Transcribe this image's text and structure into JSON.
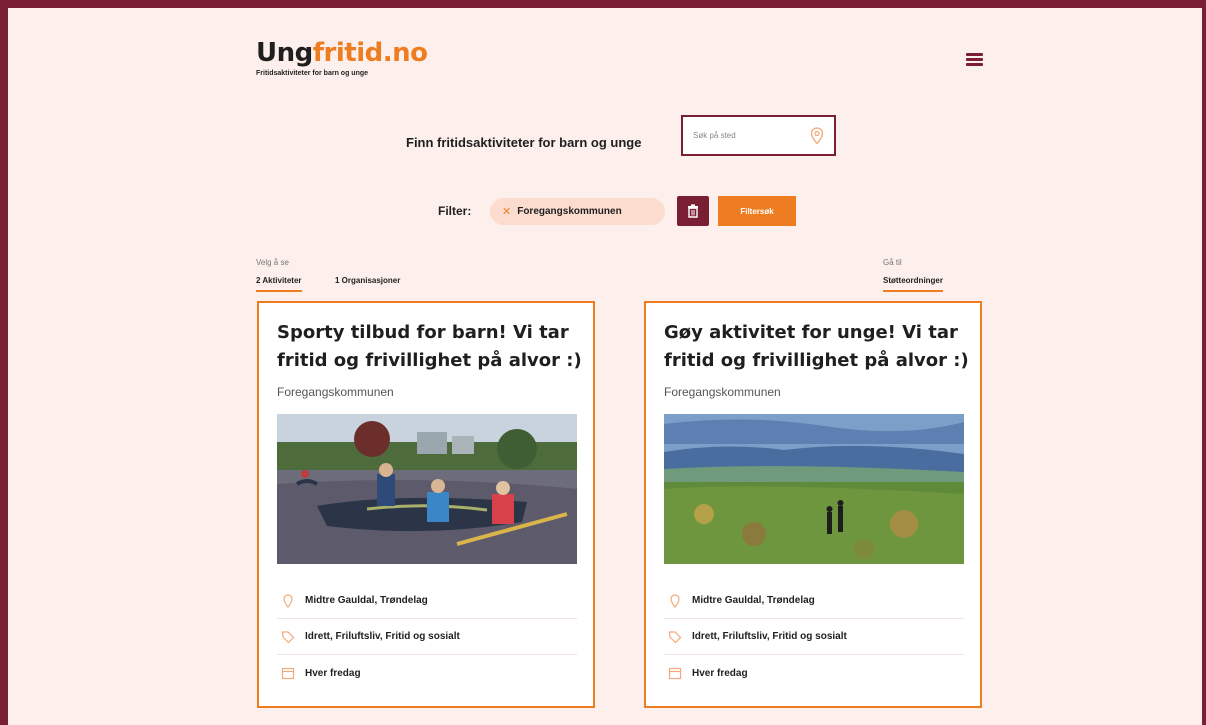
{
  "header": {
    "logo_dark": "Ung",
    "logo_orange": "fritid.no",
    "tagline": "Fritidsaktiviteter for barn og unge"
  },
  "search": {
    "label": "Finn fritidsaktiviteter for barn og unge",
    "placeholder": "Søk på sted"
  },
  "filter": {
    "label": "Filter:",
    "chip": "Foregangskommunen",
    "search_button": "Filtersøk"
  },
  "view": {
    "caption": "Velg å se",
    "tab_activities": "2 Aktiviteter",
    "tab_orgs": "1 Organisasjoner"
  },
  "goto": {
    "caption": "Gå til",
    "link": "Støtteordninger"
  },
  "cards": [
    {
      "title": "Sporty tilbud for barn! Vi tar fritid og frivillighet på alvor :)",
      "org": "Foregangskommunen",
      "location": "Midtre Gauldal, Trøndelag",
      "tags": "Idrett, Friluftsliv, Fritid og sosialt",
      "schedule": "Hver fredag"
    },
    {
      "title": "Gøy aktivitet for unge! Vi tar fritid og frivillighet på alvor :)",
      "org": "Foregangskommunen",
      "location": "Midtre Gauldal, Trøndelag",
      "tags": "Idrett, Friluftsliv, Fritid og sosialt",
      "schedule": "Hver fredag"
    }
  ],
  "colors": {
    "accent": "#ee7d21",
    "brand": "#7a1e34",
    "background": "#fdf0ec"
  }
}
